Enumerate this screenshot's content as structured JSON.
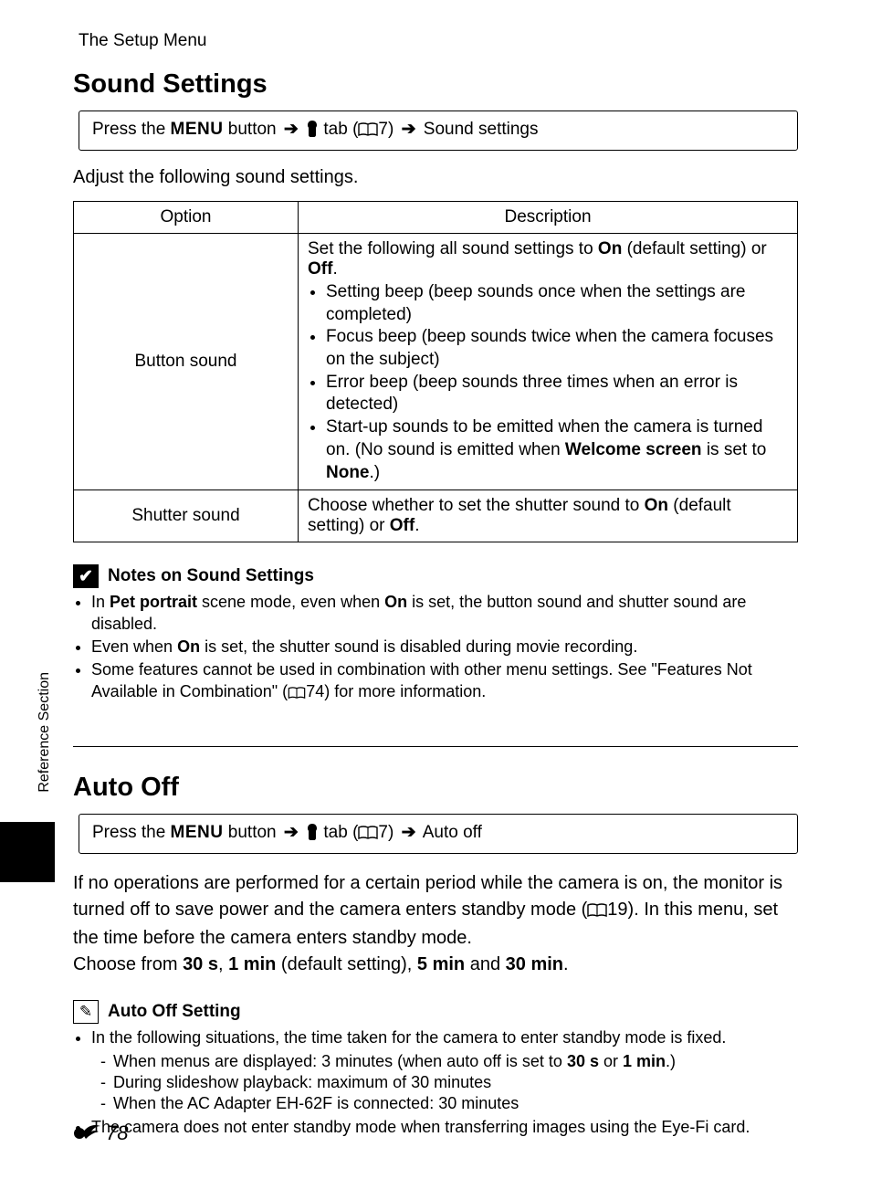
{
  "running_head": "The Setup Menu",
  "side_tab": "Reference Section",
  "page_number": "78",
  "sound": {
    "title": "Sound Settings",
    "breadcrumb": {
      "press": "Press the ",
      "menu": "MENU",
      "button": " button ",
      "tab": " tab (",
      "page_ref": "7",
      "close": ") ",
      "target": " Sound settings"
    },
    "intro": "Adjust the following sound settings.",
    "table": {
      "head_option": "Option",
      "head_desc": "Description",
      "rows": [
        {
          "option": "Button sound",
          "desc_lead": "Set the following all sound settings to ",
          "desc_on": "On",
          "desc_mid1": " (default setting) or ",
          "desc_off": "Off",
          "desc_tail1": ".",
          "bullets": [
            "Setting beep (beep sounds once when the settings are completed)",
            "Focus beep (beep sounds twice when the camera focuses on the subject)",
            "Error beep (beep sounds three times when an error is detected)"
          ],
          "bullet4_a": "Start-up sounds to be emitted when the camera is turned on. (No sound is emitted when ",
          "bullet4_b": "Welcome screen",
          "bullet4_c": " is set to ",
          "bullet4_d": "None",
          "bullet4_e": ".)"
        },
        {
          "option": "Shutter sound",
          "desc_lead": "Choose whether to set the shutter sound to ",
          "desc_on": "On",
          "desc_mid1": " (default setting) or ",
          "desc_off": "Off",
          "desc_tail1": "."
        }
      ]
    },
    "notes": {
      "title": "Notes on Sound Settings",
      "items": {
        "i1a": "In ",
        "i1b": "Pet portrait",
        "i1c": " scene mode, even when ",
        "i1d": "On",
        "i1e": " is set, the button sound and shutter sound are disabled.",
        "i2a": "Even when ",
        "i2b": "On",
        "i2c": " is set, the shutter sound is disabled during movie recording.",
        "i3a": "Some features cannot be used in combination with other menu settings. See \"Features Not Available in Combination\" (",
        "i3_ref": "74",
        "i3b": ") for more information."
      }
    }
  },
  "autooff": {
    "title": "Auto Off",
    "breadcrumb": {
      "target": " Auto off"
    },
    "para": {
      "p1": "If no operations are performed for a certain period while the camera is on, the monitor is turned off to save power and the camera enters standby mode (",
      "p1_ref": "19",
      "p1b": "). In this menu, set the time before the camera enters standby mode.",
      "p2a": "Choose from ",
      "p2_30s": "30 s",
      "p2_c1": ", ",
      "p2_1m": "1 min",
      "p2_c2": " (default setting), ",
      "p2_5m": "5 min",
      "p2_c3": " and ",
      "p2_30m": "30 min",
      "p2_c4": "."
    },
    "notes": {
      "title": "Auto Off Setting",
      "i1": "In the following situations, the time taken for the camera to enter standby mode is fixed.",
      "s1a": "When menus are displayed: 3 minutes (when auto off is set to ",
      "s1b": "30 s",
      "s1c": " or ",
      "s1d": "1 min",
      "s1e": ".)",
      "s2": "During slideshow playback: maximum of 30 minutes",
      "s3": "When the AC Adapter EH-62F is connected: 30 minutes",
      "i2": "The camera does not enter standby mode when transferring images using the Eye-Fi card."
    }
  }
}
